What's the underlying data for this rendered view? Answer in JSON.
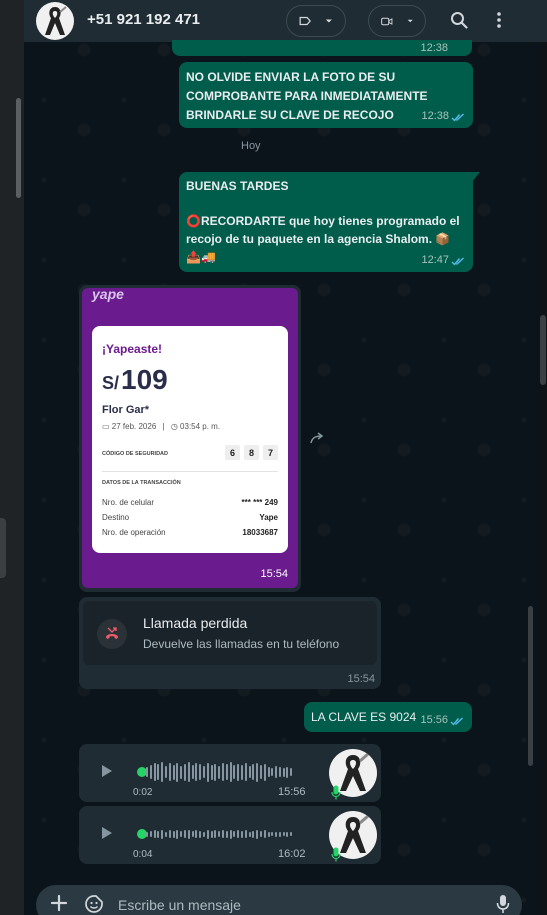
{
  "header": {
    "contact_name": "+51 921 192 471",
    "avatar_icon": "ribbon-avatar-icon",
    "label_icon": "label-icon",
    "video_icon": "video-icon",
    "search_icon": "search-icon",
    "menu_icon": "more-vertical-icon"
  },
  "messages": {
    "m1_partial_time": "12:38",
    "m2_line1": "NO OLVIDE ENVIAR LA FOTO DE SU",
    "m2_line2": "COMPROBANTE PARA INMEDIATAMENTE",
    "m2_line3": "BRINDARLE SU CLAVE DE RECOJO",
    "m2_time": "12:38",
    "day_separator": "Hoy",
    "m3_line1": "BUENAS TARDES",
    "m3_line2": "⭕RECORDARTE que hoy tienes programado el",
    "m3_line3": "recojo de tu paquete en la agencia Shalom. 📦",
    "m3_line4": "📤🚚",
    "m3_time": "12:47",
    "m6_text": "LA CLAVE ES 9024",
    "m6_time": "15:56"
  },
  "receipt": {
    "logo": "yape",
    "heading": "¡Yapeaste!",
    "currency": "S/",
    "amount": "109",
    "payee": "Flor Gar*",
    "date": "27 feb. 2026",
    "time": "03:54 p. m.",
    "security_label": "CÓDIGO DE SEGURIDAD",
    "security_digits": [
      "6",
      "8",
      "7"
    ],
    "tx_title": "DATOS DE LA TRANSACCIÓN",
    "rows": [
      {
        "label": "Nro. de celular",
        "value": "*** *** 249"
      },
      {
        "label": "Destino",
        "value": "Yape"
      },
      {
        "label": "Nro. de operación",
        "value": "18033687"
      }
    ],
    "image_time": "15:54"
  },
  "missed_call": {
    "title": "Llamada perdida",
    "subtitle": "Devuelve las llamadas en tu teléfono",
    "time": "15:54"
  },
  "voice_notes": [
    {
      "duration": "0:02",
      "time": "15:56"
    },
    {
      "duration": "0:04",
      "time": "16:02"
    }
  ],
  "composer": {
    "placeholder": "Escribe un mensaje"
  },
  "colors": {
    "outgoing": "#005c4b",
    "incoming": "#202c33",
    "accent": "#26d367",
    "yape_purple": "#6a1b8e"
  }
}
